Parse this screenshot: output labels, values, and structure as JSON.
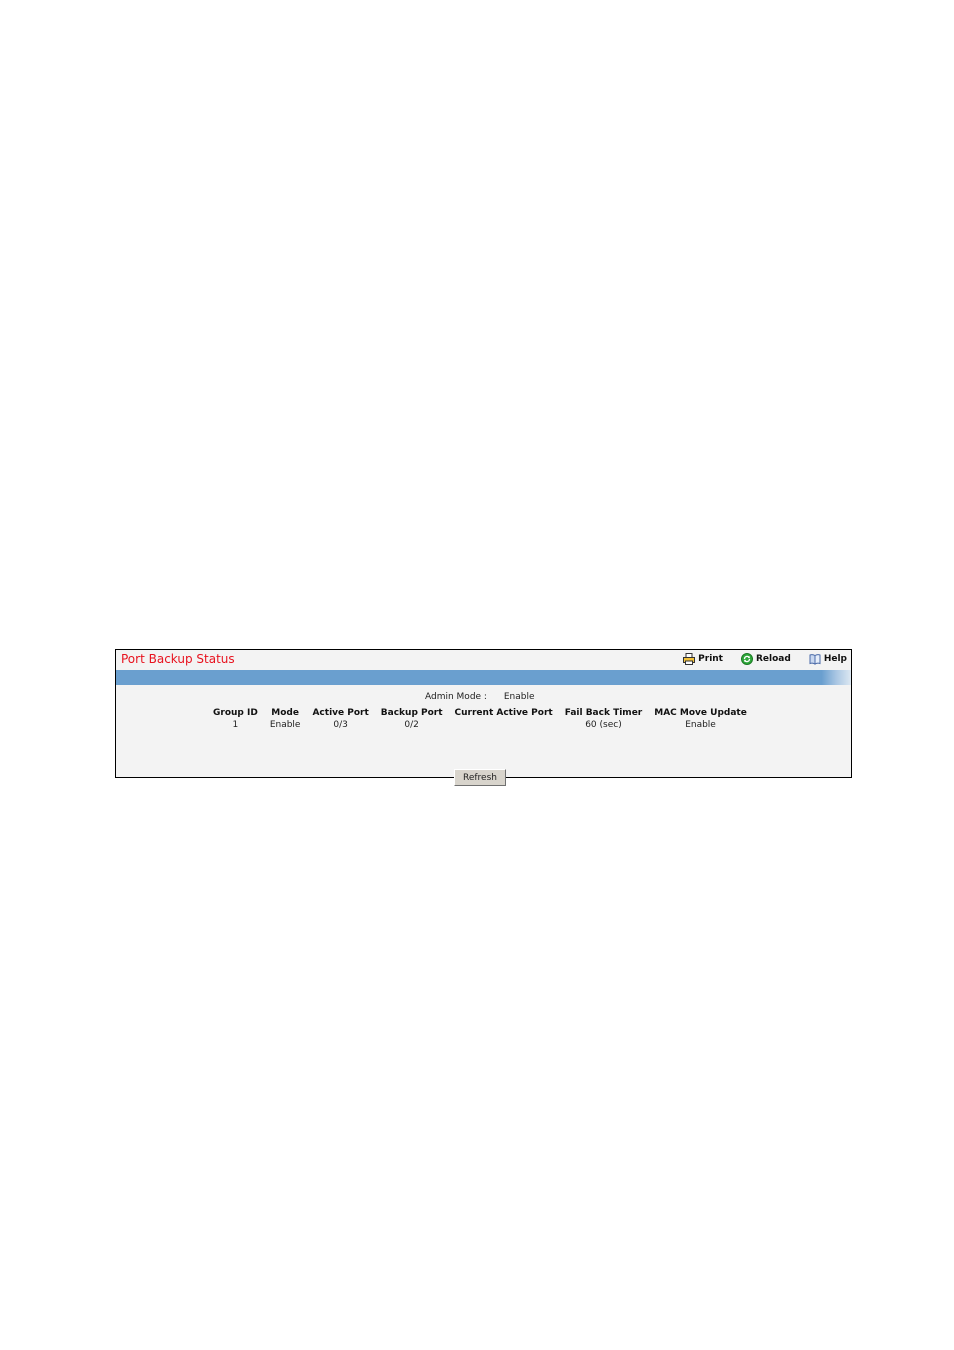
{
  "page": {
    "title": "Port Backup Status"
  },
  "toolbar": {
    "print_label": "Print",
    "reload_label": "Reload",
    "help_label": "Help",
    "print_icon": "printer-icon",
    "reload_icon": "reload-icon",
    "help_icon": "help-book-icon"
  },
  "colors": {
    "title": "#e8121e",
    "header_bar": "#6a9fcf",
    "panel_bg": "#f3f3f3",
    "button_bg": "#d8d4cc"
  },
  "admin_mode": {
    "label": "Admin Mode :",
    "value": "Enable"
  },
  "table": {
    "columns": [
      "Group ID",
      "Mode",
      "Active Port",
      "Backup Port",
      "Current Active Port",
      "Fail Back Timer",
      "MAC Move Update"
    ],
    "rows": [
      [
        "1",
        "Enable",
        "0/3",
        "0/2",
        "",
        "60 (sec)",
        "Enable"
      ]
    ]
  },
  "buttons": {
    "refresh_label": "Refresh"
  }
}
